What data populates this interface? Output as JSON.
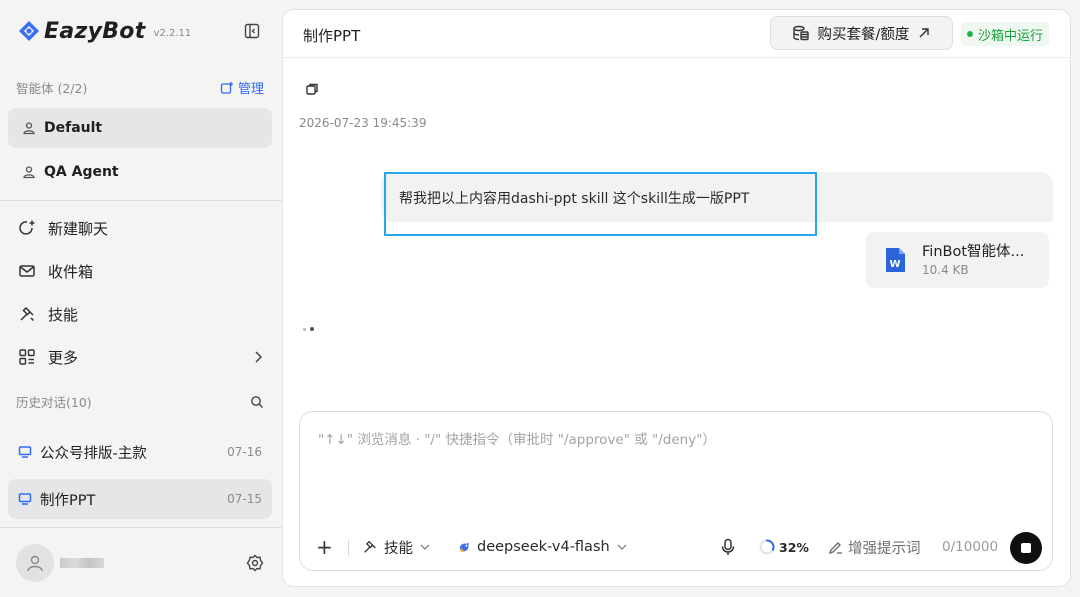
{
  "app": {
    "name": "EazyBot",
    "version": "v2.2.11"
  },
  "sidebar": {
    "agents_header": "智能体 (2/2)",
    "manage_label": "管理",
    "agents": [
      {
        "label": "Default",
        "active": true
      },
      {
        "label": "QA Agent",
        "active": false
      }
    ],
    "nav": [
      {
        "label": "新建聊天",
        "icon": "new-chat-icon"
      },
      {
        "label": "收件箱",
        "icon": "inbox-icon"
      },
      {
        "label": "技能",
        "icon": "skill-icon"
      },
      {
        "label": "更多",
        "icon": "more-grid-icon"
      }
    ],
    "history_header": "历史对话(10)",
    "history": [
      {
        "label": "公众号排版-主款",
        "date": "07-16",
        "active": false
      },
      {
        "label": "制作PPT",
        "date": "07-15",
        "active": true
      }
    ]
  },
  "header": {
    "title": "制作PPT",
    "buy_label": "购买套餐/额度",
    "sandbox_label": "沙箱中运行"
  },
  "chat": {
    "timestamp": "2026-07-23 19:45:39",
    "user_message": "帮我把以上内容用dashi-ppt skill 这个skill生成一版PPT",
    "file": {
      "name": "FinBot智能体...",
      "size": "10.4 KB",
      "icon_letter": "W"
    }
  },
  "composer": {
    "placeholder": "\"↑↓\" 浏览消息 · \"/\" 快捷指令（审批时 \"/approve\" 或 \"/deny\"）",
    "value": "",
    "add_label": "+",
    "skill_label": "技能",
    "model_label": "deepseek-v4-flash",
    "progress_label": "32%",
    "progress_fraction": 0.32,
    "enhance_label": "增强提示词",
    "char_count": "0/10000"
  },
  "colors": {
    "accent": "#2f6bf0",
    "highlight_border": "#2aa6e6",
    "sandbox_green": "#1a9f3c"
  }
}
